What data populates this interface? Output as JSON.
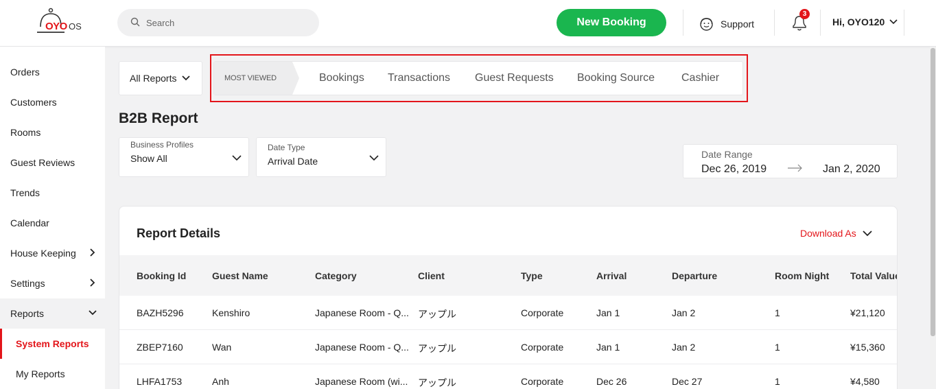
{
  "app": {
    "logo_text": "OYO",
    "logo_suffix": "OS"
  },
  "search": {
    "placeholder": "Search"
  },
  "header": {
    "new_booking_label": "New Booking",
    "support_label": "Support",
    "notification_count": "3",
    "user_greeting": "Hi, OYO120"
  },
  "sidebar": {
    "items": [
      {
        "label": "Orders"
      },
      {
        "label": "Customers"
      },
      {
        "label": "Rooms"
      },
      {
        "label": "Guest Reviews"
      },
      {
        "label": "Trends"
      },
      {
        "label": "Calendar"
      },
      {
        "label": "House Keeping"
      },
      {
        "label": "Settings"
      },
      {
        "label": "Reports"
      }
    ],
    "sub_items": [
      {
        "label": "System Reports",
        "selected": true
      },
      {
        "label": "My Reports",
        "selected": false
      }
    ]
  },
  "reports_nav": {
    "all_reports_label": "All Reports",
    "most_viewed_label": "MOST VIEWED",
    "tabs": [
      {
        "label": "Bookings"
      },
      {
        "label": "Transactions"
      },
      {
        "label": "Guest Requests"
      },
      {
        "label": "Booking Source"
      },
      {
        "label": "Cashier"
      }
    ]
  },
  "page": {
    "title": "B2B Report"
  },
  "filters": {
    "business_profiles": {
      "label": "Business Profiles",
      "value": "Show All"
    },
    "date_type": {
      "label": "Date Type",
      "value": "Arrival Date"
    },
    "date_range": {
      "label": "Date Range",
      "from": "Dec 26, 2019",
      "to": "Jan 2, 2020"
    }
  },
  "report": {
    "title": "Report Details",
    "download_label": "Download As",
    "columns": [
      "Booking Id",
      "Guest Name",
      "Category",
      "Client",
      "Type",
      "Arrival",
      "Departure",
      "Room Night",
      "Total Value"
    ],
    "rows": [
      [
        "BAZH5296",
        "Kenshiro",
        "Japanese Room - Q...",
        "アップル",
        "Corporate",
        "Jan 1",
        "Jan 2",
        "1",
        "¥21,120"
      ],
      [
        "ZBEP7160",
        "Wan",
        "Japanese Room - Q...",
        "アップル",
        "Corporate",
        "Jan 1",
        "Jan 2",
        "1",
        "¥15,360"
      ],
      [
        "LHFA1753",
        "Anh",
        "Japanese Room (wi...",
        "アップル",
        "Corporate",
        "Dec 26",
        "Dec 27",
        "1",
        "¥4,580"
      ]
    ]
  },
  "colors": {
    "brand_red": "#e3151a",
    "primary_green": "#1ab64f"
  }
}
